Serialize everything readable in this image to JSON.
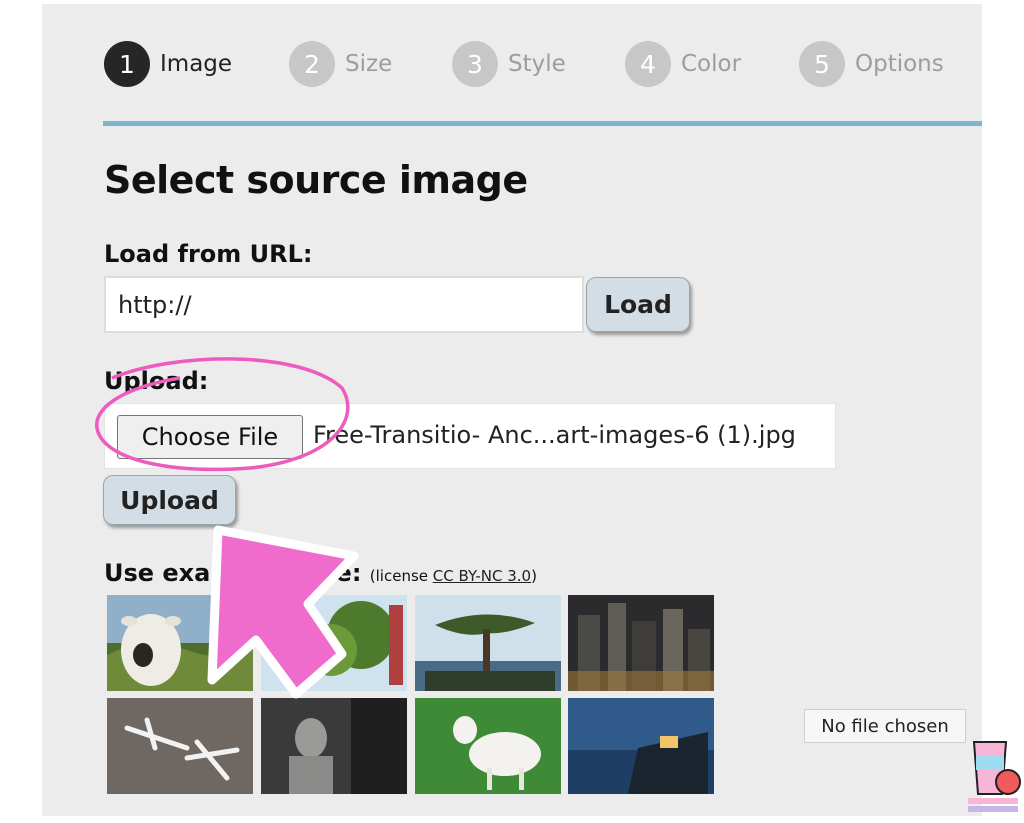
{
  "steps": [
    {
      "num": "1",
      "label": "Image"
    },
    {
      "num": "2",
      "label": "Size"
    },
    {
      "num": "3",
      "label": "Style"
    },
    {
      "num": "4",
      "label": "Color"
    },
    {
      "num": "5",
      "label": "Options"
    }
  ],
  "heading": "Select source image",
  "url_section": {
    "label": "Load from URL:",
    "value": "http://",
    "button_label": "Load"
  },
  "upload_section": {
    "label": "Upload:",
    "choose_label": "Choose File",
    "file_name": "Free-Transitio- Anc...art-images-6 (1).jpg",
    "button_label": "Upload"
  },
  "examples": {
    "label_prefix": "Use exa",
    "label_suffix": "ge:",
    "license_open": "(license ",
    "license_link": "CC BY-NC 3.0",
    "license_close": ")",
    "thumbnails": [
      "cow-photo",
      "tree-photo",
      "pine-tree-lake-photo",
      "city-night-photo",
      "airplanes-photo",
      "statue-photo",
      "sheep-photo",
      "lakeside-house-photo"
    ]
  },
  "tooltip": "No file chosen",
  "colors": {
    "accent_rule": "#7fb6cf",
    "highlight_pink": "#ee5bbf",
    "button_bg": "#d3dde5"
  }
}
